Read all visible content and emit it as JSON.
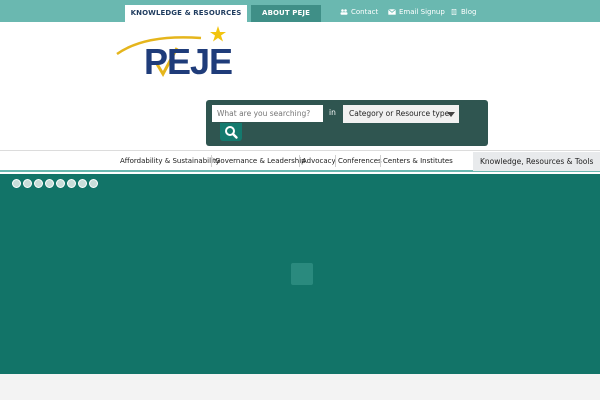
{
  "topbar": {
    "tabs": [
      {
        "label": "KNOWLEDGE & RESOURCES"
      },
      {
        "label": "ABOUT PEJE"
      }
    ],
    "links": [
      {
        "label": "Contact",
        "icon": "people-icon"
      },
      {
        "label": "Email Signup",
        "icon": "envelope-icon"
      },
      {
        "label": "Blog",
        "icon": "document-icon"
      }
    ]
  },
  "logo": {
    "text": "PEJE"
  },
  "search": {
    "placeholder": "What are you searching?",
    "in_label": "in",
    "category_value": "Category or Resource type"
  },
  "nav": {
    "items": [
      {
        "label": "Affordability & Sustainability"
      },
      {
        "label": "Governance & Leadership"
      },
      {
        "label": "Advocacy"
      },
      {
        "label": "Conferences"
      },
      {
        "label": "Centers & Institutes"
      }
    ],
    "tools_label": "Knowledge, Resources & Tools"
  },
  "hero": {
    "slide_count": 8
  },
  "colors": {
    "topbar": "#6ab8b0",
    "hero": "#127468",
    "navy": "#1f3c5f",
    "search_panel": "#2f5550"
  }
}
